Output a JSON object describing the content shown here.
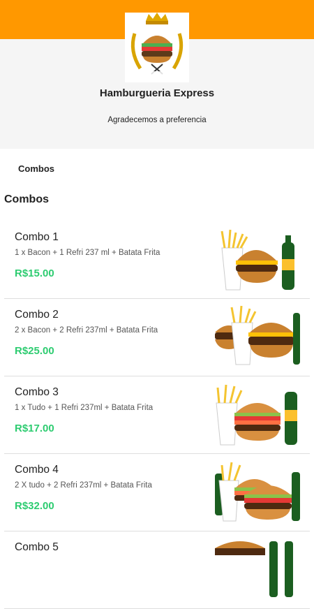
{
  "store": {
    "name": "Hamburgueria Express",
    "subtitle": "Agradecemos a preferencia",
    "logo_text": "HAMBURGUERIA EXPRESS"
  },
  "colors": {
    "top_bar": "#ff9800",
    "price": "#2ecc71"
  },
  "category_tab": "Combos",
  "section_title": "Combos",
  "items": [
    {
      "name": "Combo 1",
      "description": "1 x Bacon + 1 Refri 237 ml + Batata Frita",
      "price": "R$15.00",
      "image": "combo-1-image"
    },
    {
      "name": "Combo 2",
      "description": "2 x Bacon + 2 Refri 237ml + Batata Frita",
      "price": "R$25.00",
      "image": "combo-2-image"
    },
    {
      "name": "Combo 3",
      "description": "1 x Tudo + 1 Refri 237ml + Batata Frita",
      "price": "R$17.00",
      "image": "combo-3-image"
    },
    {
      "name": "Combo 4",
      "description": "2 X tudo + 2 Refri 237ml + Batata Frita",
      "price": "R$32.00",
      "image": "combo-4-image"
    },
    {
      "name": "Combo 5",
      "description": "",
      "price": "",
      "image": "combo-5-image"
    }
  ]
}
